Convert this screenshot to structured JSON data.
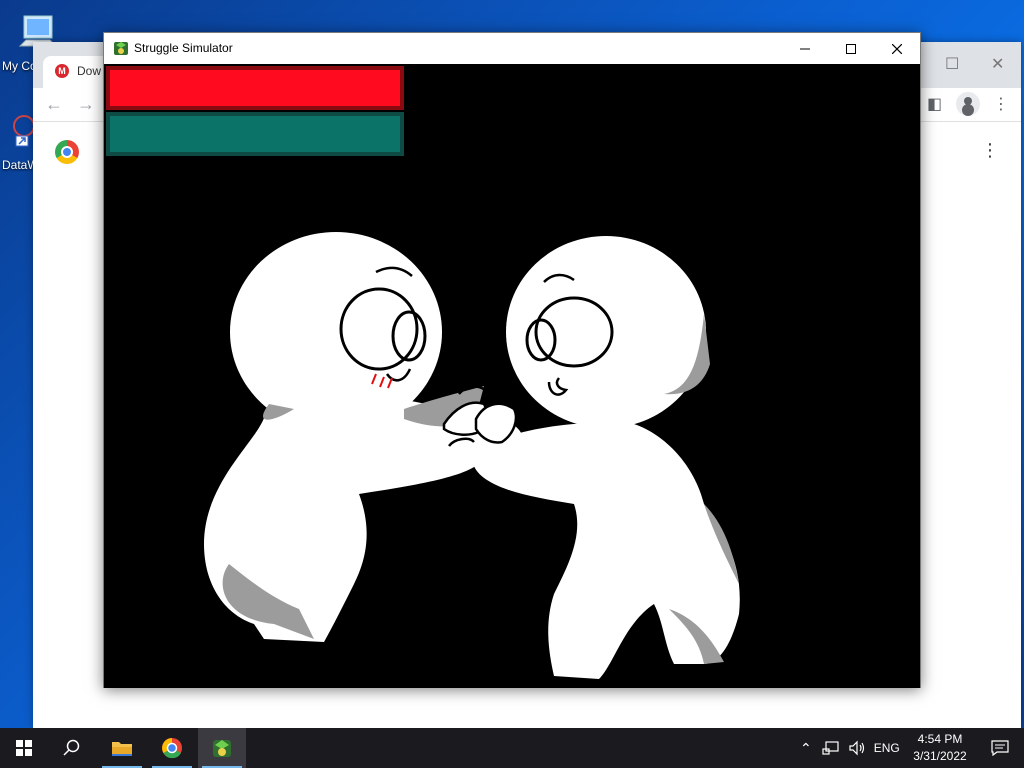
{
  "desktop": {
    "icons": [
      {
        "label": "My Co",
        "icon": "computer-icon"
      },
      {
        "label": "DataW",
        "icon": "shortcut-icon"
      }
    ]
  },
  "background_window": {
    "app": "Google Chrome",
    "tab_title": "Dow",
    "tab_icon": "mega-icon"
  },
  "game_window": {
    "title": "Struggle Simulator",
    "controls": {
      "minimize": "minimize-icon",
      "maximize": "maximize-icon",
      "close": "close-icon"
    },
    "hud": {
      "bars": [
        {
          "name": "health-bar",
          "color": "#ff0a1e",
          "fill_fraction": 1.0
        },
        {
          "name": "stamina-bar",
          "color": "#0b7368",
          "fill_fraction": 1.0
        }
      ]
    }
  },
  "taskbar": {
    "items": [
      {
        "name": "start",
        "icon": "windows-icon"
      },
      {
        "name": "search",
        "icon": "search-icon"
      },
      {
        "name": "file-explorer",
        "icon": "folder-icon"
      },
      {
        "name": "chrome",
        "icon": "chrome-icon"
      },
      {
        "name": "struggle-simulator",
        "icon": "game-icon",
        "active": true
      }
    ],
    "tray": {
      "language": "ENG",
      "time": "4:54 PM",
      "date": "3/31/2022"
    }
  },
  "colors": {
    "accent": "#0b5fd0",
    "health": "#ff0a1e",
    "stamina": "#0b7368"
  }
}
